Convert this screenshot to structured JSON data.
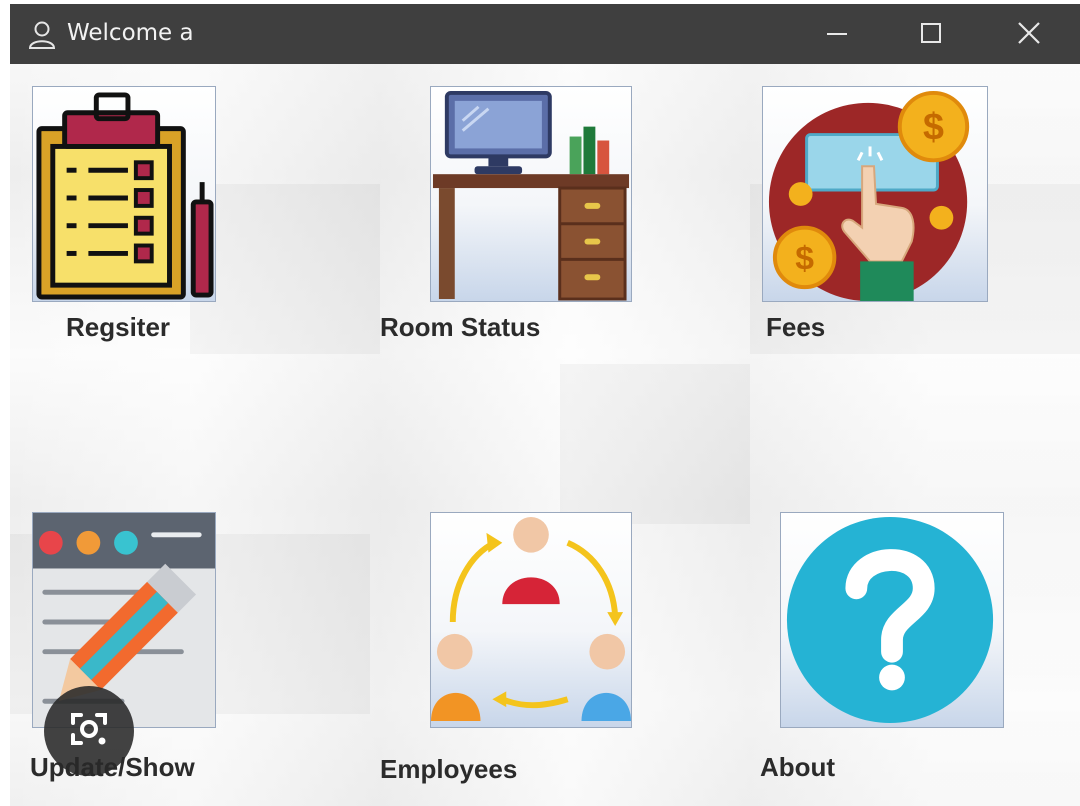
{
  "window": {
    "title": "Welcome a",
    "icons": {
      "app": "user-icon",
      "minimize": "minimize-icon",
      "maximize": "maximize-icon",
      "close": "close-icon"
    },
    "titlebar_color": "#3f3f3f"
  },
  "tiles": [
    {
      "label": "Regsiter",
      "icon": "clipboard-checklist-icon"
    },
    {
      "label": "Room Status",
      "icon": "desk-computer-icon"
    },
    {
      "label": "Fees",
      "icon": "payment-coins-icon"
    },
    {
      "label": "Update/Show",
      "icon": "edit-pencil-icon"
    },
    {
      "label": "Employees",
      "icon": "people-cycle-icon"
    },
    {
      "label": "About",
      "icon": "question-mark-icon"
    }
  ],
  "overlay": {
    "icon": "lens-camera-icon"
  }
}
